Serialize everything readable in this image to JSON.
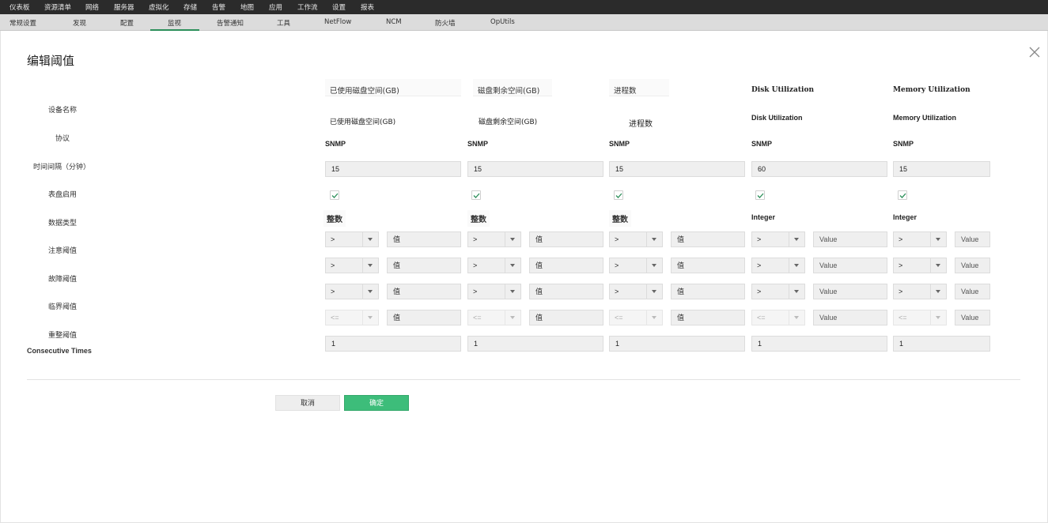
{
  "topnav": [
    "仪表板",
    "资源清单",
    "网络",
    "服务器",
    "虚拟化",
    "存储",
    "告警",
    "地图",
    "应用",
    "工作流",
    "设置",
    "报表"
  ],
  "subnav": {
    "items": [
      "常规设置",
      "发现",
      "配置",
      "监视",
      "告警通知",
      "工具",
      "NetFlow",
      "NCM",
      "防火墙",
      "OpUtils"
    ],
    "active": "监视"
  },
  "dialog": {
    "title": "编辑阈值",
    "close_label": "×",
    "row_labels": [
      "设备名称",
      "协议",
      "时间间隔（分钟）",
      "表盘启用",
      "数据类型",
      "注意阈值",
      "故障阈值",
      "临界阈值",
      "重整阈值",
      "Consecutive Times"
    ],
    "columns": [
      {
        "header": "已使用磁盘空间(GB)",
        "device_name": "已使用磁盘空间(GB)",
        "protocol": "SNMP",
        "interval": "15",
        "data_type": "整数",
        "attention": {
          "op": ">",
          "value_placeholder": "值"
        },
        "trouble": {
          "op": ">",
          "value_placeholder": "值"
        },
        "critical": {
          "op": ">",
          "value_placeholder": "值"
        },
        "rearm": {
          "op": "<=",
          "value_placeholder": "值"
        },
        "consecutive": "1"
      },
      {
        "header": "磁盘剩余空间(GB)",
        "device_name": "磁盘剩余空间(GB)",
        "protocol": "SNMP",
        "interval": "15",
        "data_type": "整数",
        "attention": {
          "op": ">",
          "value_placeholder": "值"
        },
        "trouble": {
          "op": ">",
          "value_placeholder": "值"
        },
        "critical": {
          "op": ">",
          "value_placeholder": "值"
        },
        "rearm": {
          "op": "<=",
          "value_placeholder": "值"
        },
        "consecutive": "1"
      },
      {
        "header": "进程数",
        "device_name": "进程数",
        "protocol": "SNMP",
        "interval": "15",
        "data_type": "整数",
        "attention": {
          "op": ">",
          "value_placeholder": "值"
        },
        "trouble": {
          "op": ">",
          "value_placeholder": "值"
        },
        "critical": {
          "op": ">",
          "value_placeholder": "值"
        },
        "rearm": {
          "op": "<=",
          "value_placeholder": "值"
        },
        "consecutive": "1"
      },
      {
        "header": "Disk Utilization",
        "device_name": "Disk Utilization",
        "protocol": "SNMP",
        "interval": "60",
        "data_type": "Integer",
        "attention": {
          "op": ">",
          "value_placeholder": "Value"
        },
        "trouble": {
          "op": ">",
          "value_placeholder": "Value"
        },
        "critical": {
          "op": ">",
          "value_placeholder": "Value"
        },
        "rearm": {
          "op": "<=",
          "value_placeholder": "Value"
        },
        "consecutive": "1"
      },
      {
        "header": "Memory Utilization",
        "device_name": "Memory Utilization",
        "protocol": "SNMP",
        "interval": "15",
        "data_type": "Integer",
        "attention": {
          "op": ">",
          "value_placeholder": "Value"
        },
        "trouble": {
          "op": ">",
          "value_placeholder": "Value"
        },
        "critical": {
          "op": ">",
          "value_placeholder": "Value"
        },
        "rearm": {
          "op": "<=",
          "value_placeholder": "Value"
        },
        "consecutive": "1"
      }
    ],
    "dial_enabled": [
      true,
      true,
      true,
      true,
      true
    ],
    "cancel_label": "取消",
    "ok_label": "确定"
  },
  "colors": {
    "accent": "#3dbd7a",
    "active_tab": "#2c8f5a",
    "topnav_bg": "#2b2b2b",
    "subnav_bg": "#dcdcdc"
  }
}
